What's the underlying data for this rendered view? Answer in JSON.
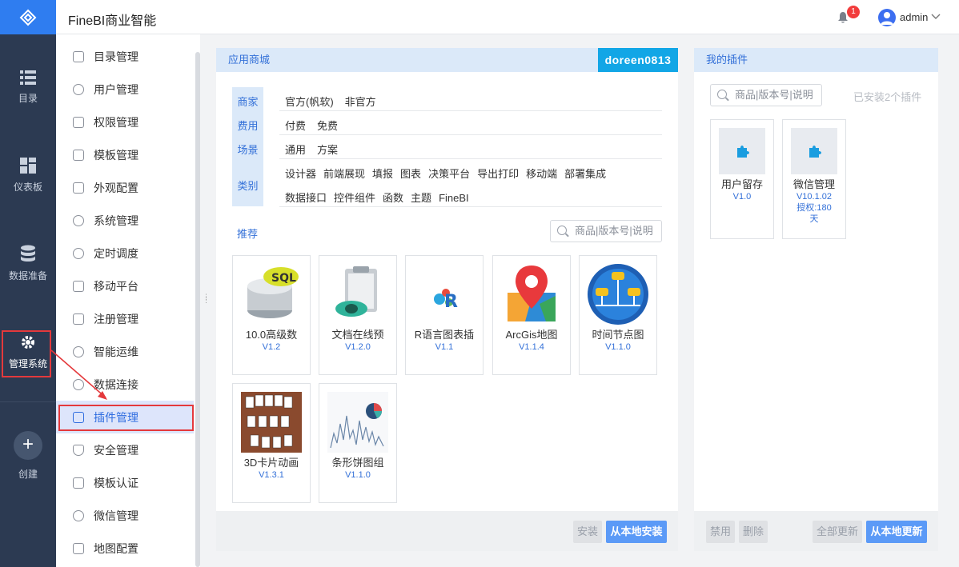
{
  "header": {
    "app_title": "FineBI商业智能",
    "notification_count": "1",
    "user_name": "admin"
  },
  "rail": {
    "items": [
      {
        "label": "目录",
        "icon": "list-icon"
      },
      {
        "label": "仪表板",
        "icon": "dashboard-icon"
      },
      {
        "label": "数据准备",
        "icon": "database-icon"
      },
      {
        "label": "管理系统",
        "icon": "gear-icon"
      },
      {
        "label": "创建",
        "icon": "plus-icon"
      }
    ]
  },
  "menu": {
    "items": [
      {
        "label": "目录管理"
      },
      {
        "label": "用户管理"
      },
      {
        "label": "权限管理"
      },
      {
        "label": "模板管理"
      },
      {
        "label": "外观配置"
      },
      {
        "label": "系统管理"
      },
      {
        "label": "定时调度"
      },
      {
        "label": "移动平台"
      },
      {
        "label": "注册管理"
      },
      {
        "label": "智能运维"
      },
      {
        "label": "数据连接"
      },
      {
        "label": "插件管理"
      },
      {
        "label": "安全管理"
      },
      {
        "label": "模板认证"
      },
      {
        "label": "微信管理"
      },
      {
        "label": "地图配置"
      }
    ],
    "active_index": 11
  },
  "store": {
    "title": "应用商城",
    "user_tag": "doreen0813",
    "filters": {
      "merchant_label": "商家",
      "merchant_options": [
        "官方(帆软)",
        "非官方"
      ],
      "fee_label": "费用",
      "fee_options": [
        "付费",
        "免费"
      ],
      "scene_label": "场景",
      "scene_options": [
        "通用",
        "方案"
      ],
      "category_label": "类别",
      "category_row1": [
        "设计器",
        "前端展现",
        "填报",
        "图表",
        "决策平台",
        "导出打印",
        "移动端",
        "部署集成"
      ],
      "category_row2": [
        "数据接口",
        "控件组件",
        "函数",
        "主题",
        "FineBI"
      ]
    },
    "recommend_label": "推荐",
    "search_placeholder": "商品|版本号|说明",
    "cards": [
      {
        "name": "10.0高级数",
        "version": "V1.2"
      },
      {
        "name": "文档在线预",
        "version": "V1.2.0"
      },
      {
        "name": "R语言图表插",
        "version": "V1.1"
      },
      {
        "name": "ArcGis地图",
        "version": "V1.1.4"
      },
      {
        "name": "时间节点图",
        "version": "V1.1.0"
      },
      {
        "name": "3D卡片动画",
        "version": "V1.3.1"
      },
      {
        "name": "条形饼图组",
        "version": "V1.1.0"
      }
    ],
    "install_label": "安装",
    "local_install_label": "从本地安装"
  },
  "mine": {
    "title": "我的插件",
    "search_placeholder": "商品|版本号|说明",
    "installed_count": "已安装2个插件",
    "cards": [
      {
        "name": "用户留存",
        "version": "V1.0",
        "extra": ""
      },
      {
        "name": "微信管理",
        "version": "V10.1.02",
        "extra": "授权:180天"
      }
    ],
    "disable_label": "禁用",
    "delete_label": "删除",
    "update_all_label": "全部更新",
    "local_update_label": "从本地更新"
  }
}
